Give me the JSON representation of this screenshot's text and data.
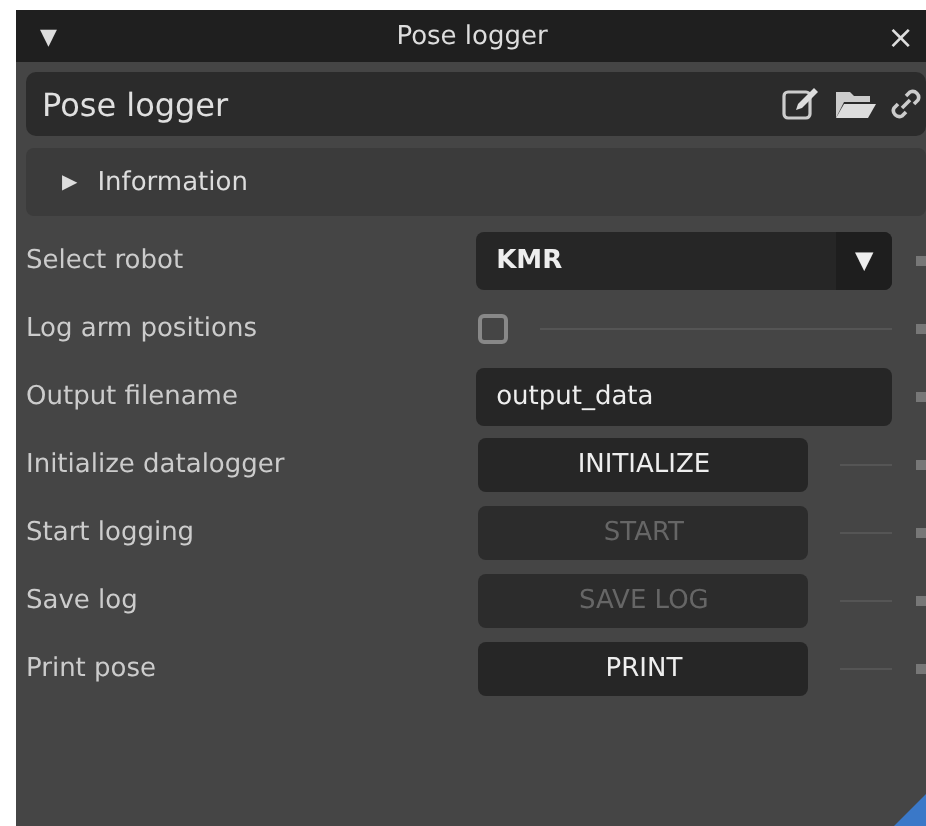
{
  "window": {
    "title": "Pose logger",
    "menu_glyph": "▼",
    "close_glyph": "×"
  },
  "header": {
    "title": "Pose logger"
  },
  "information": {
    "glyph": "▶",
    "label": "Information",
    "expanded": false
  },
  "rows": [
    {
      "kind": "dropdown",
      "label": "Select robot",
      "value": "KMR",
      "glyph": "▼"
    },
    {
      "kind": "checkbox",
      "label": "Log arm positions",
      "checked": false
    },
    {
      "kind": "text",
      "label": "Output filename",
      "value": "output_data"
    },
    {
      "kind": "button",
      "label": "Initialize datalogger",
      "button": "INITIALIZE",
      "disabled": false
    },
    {
      "kind": "button",
      "label": "Start logging",
      "button": "START",
      "disabled": true
    },
    {
      "kind": "button",
      "label": "Save log",
      "button": "SAVE LOG",
      "disabled": true
    },
    {
      "kind": "button",
      "label": "Print pose",
      "button": "PRINT",
      "disabled": false
    }
  ]
}
